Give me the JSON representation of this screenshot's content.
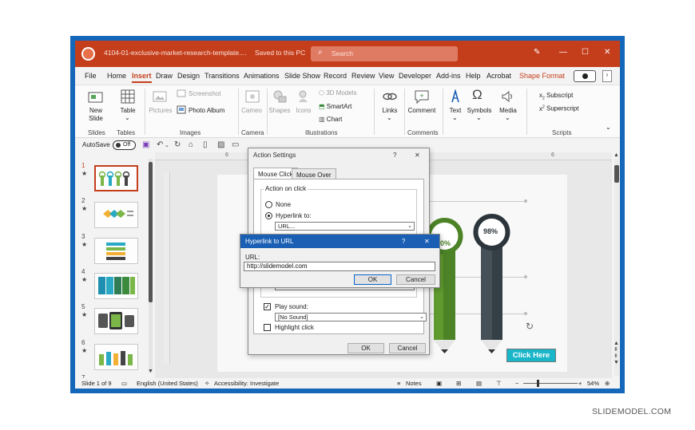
{
  "titlebar": {
    "file_name": "4104-01-exclusive-market-research-template....",
    "save_status": "Saved to this PC",
    "search_placeholder": "Search"
  },
  "menu": [
    "File",
    "Home",
    "Insert",
    "Draw",
    "Design",
    "Transitions",
    "Animations",
    "Slide Show",
    "Record",
    "Review",
    "View",
    "Developer",
    "Add-ins",
    "Help",
    "Acrobat",
    "Shape Format"
  ],
  "ribbon": {
    "new_slide": "New Slide",
    "table": "Table",
    "pictures": "Pictures",
    "screenshot": "Screenshot",
    "photo_album": "Photo Album",
    "cameo": "Cameo",
    "shapes": "Shapes",
    "icons": "Icons",
    "models_3d": "3D Models",
    "smartart": "SmartArt",
    "chart": "Chart",
    "links": "Links",
    "comment": "Comment",
    "text": "Text",
    "symbols": "Symbols",
    "media": "Media",
    "subscript": "Subscript",
    "superscript": "Superscript",
    "groups": {
      "slides": "Slides",
      "tables": "Tables",
      "images": "Images",
      "camera": "Camera",
      "illustrations": "Illustrations",
      "comments": "Comments",
      "scripts": "Scripts"
    }
  },
  "qat": {
    "autosave": "AutoSave",
    "toggle": "Off"
  },
  "thumbnails": [
    "1",
    "2",
    "3",
    "4",
    "5",
    "6",
    "7"
  ],
  "ruler_label": "6",
  "slide": {
    "pct_green": "80%",
    "pct_dark": "98%",
    "click_here": "Click Here"
  },
  "action_settings": {
    "title": "Action Settings",
    "help": "?",
    "close": "✕",
    "tab_click": "Mouse Click",
    "tab_over": "Mouse Over",
    "group_label": "Action on click",
    "none": "None",
    "hyperlink_to": "Hyperlink to:",
    "hyperlink_value": "URL...",
    "play_sound": "Play sound:",
    "sound_value": "[No Sound]",
    "highlight_click": "Highlight click",
    "ok": "OK",
    "cancel": "Cancel"
  },
  "hyperlink_dialog": {
    "title": "Hyperlink to URL",
    "help": "?",
    "close": "✕",
    "url_label": "URL:",
    "url_value": "http://slidemodel.com",
    "ok": "OK",
    "cancel": "Cancel"
  },
  "status": {
    "slide": "Slide 1 of 9",
    "language": "English (United States)",
    "accessibility": "Accessibility: Investigate",
    "notes": "Notes",
    "zoom": "54%"
  },
  "brand": "SLIDEMODEL.COM",
  "colors": {
    "accent": "#c43e1c",
    "frame": "#1567b9",
    "dialog_title": "#1a5fb4",
    "green": "#5f9a2f",
    "cyan": "#19b5c9"
  }
}
